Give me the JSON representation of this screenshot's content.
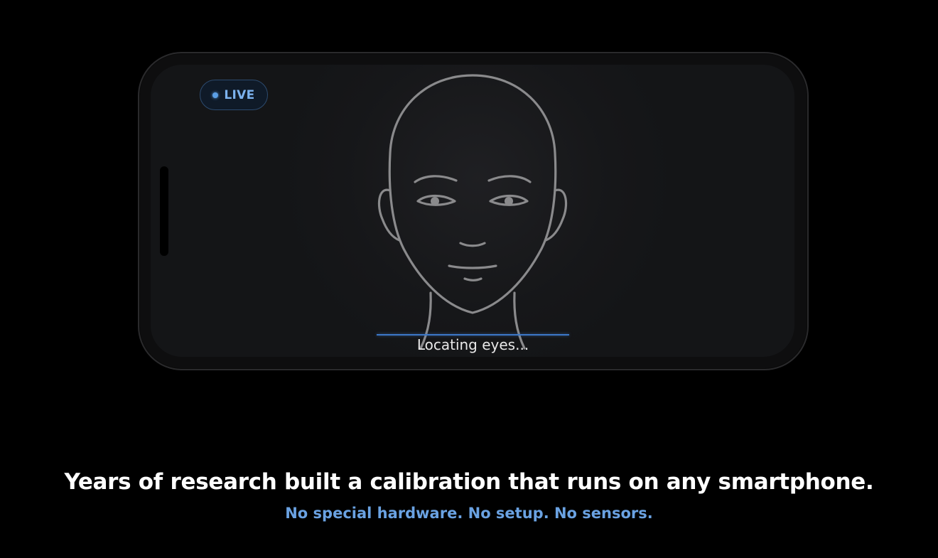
{
  "device": {
    "badge": {
      "label": "LIVE",
      "color": "#5b9fe6"
    },
    "status_text": "Locating eyes...",
    "face_icon": "face-outline-icon",
    "scan_color": "#3c78c8"
  },
  "caption": {
    "headline": "Years of research built a calibration that runs on any smartphone.",
    "subline": "No special hardware. No setup. No sensors.",
    "subline_color": "#6aa2e2"
  }
}
